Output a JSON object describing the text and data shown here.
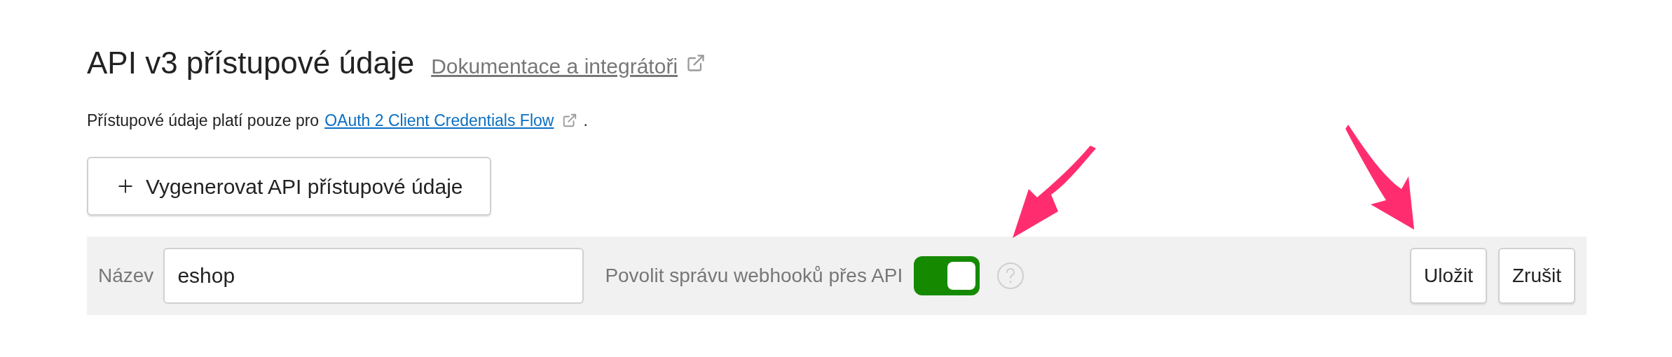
{
  "header": {
    "title": "API v3 přístupové údaje",
    "doc_link": "Dokumentace a integrátoři"
  },
  "intro": {
    "text": "Přístupové údaje platí pouze pro",
    "link": "OAuth 2 Client Credentials Flow",
    "end": "."
  },
  "generate_button": {
    "label": "Vygenerovat API přístupové údaje"
  },
  "form": {
    "name_label": "Název",
    "name_value": "eshop",
    "webhook_label": "Povolit správu webhooků přes API",
    "webhook_on": true,
    "buttons": [
      {
        "label": "Uložit"
      },
      {
        "label": "Zrušit"
      }
    ]
  }
}
